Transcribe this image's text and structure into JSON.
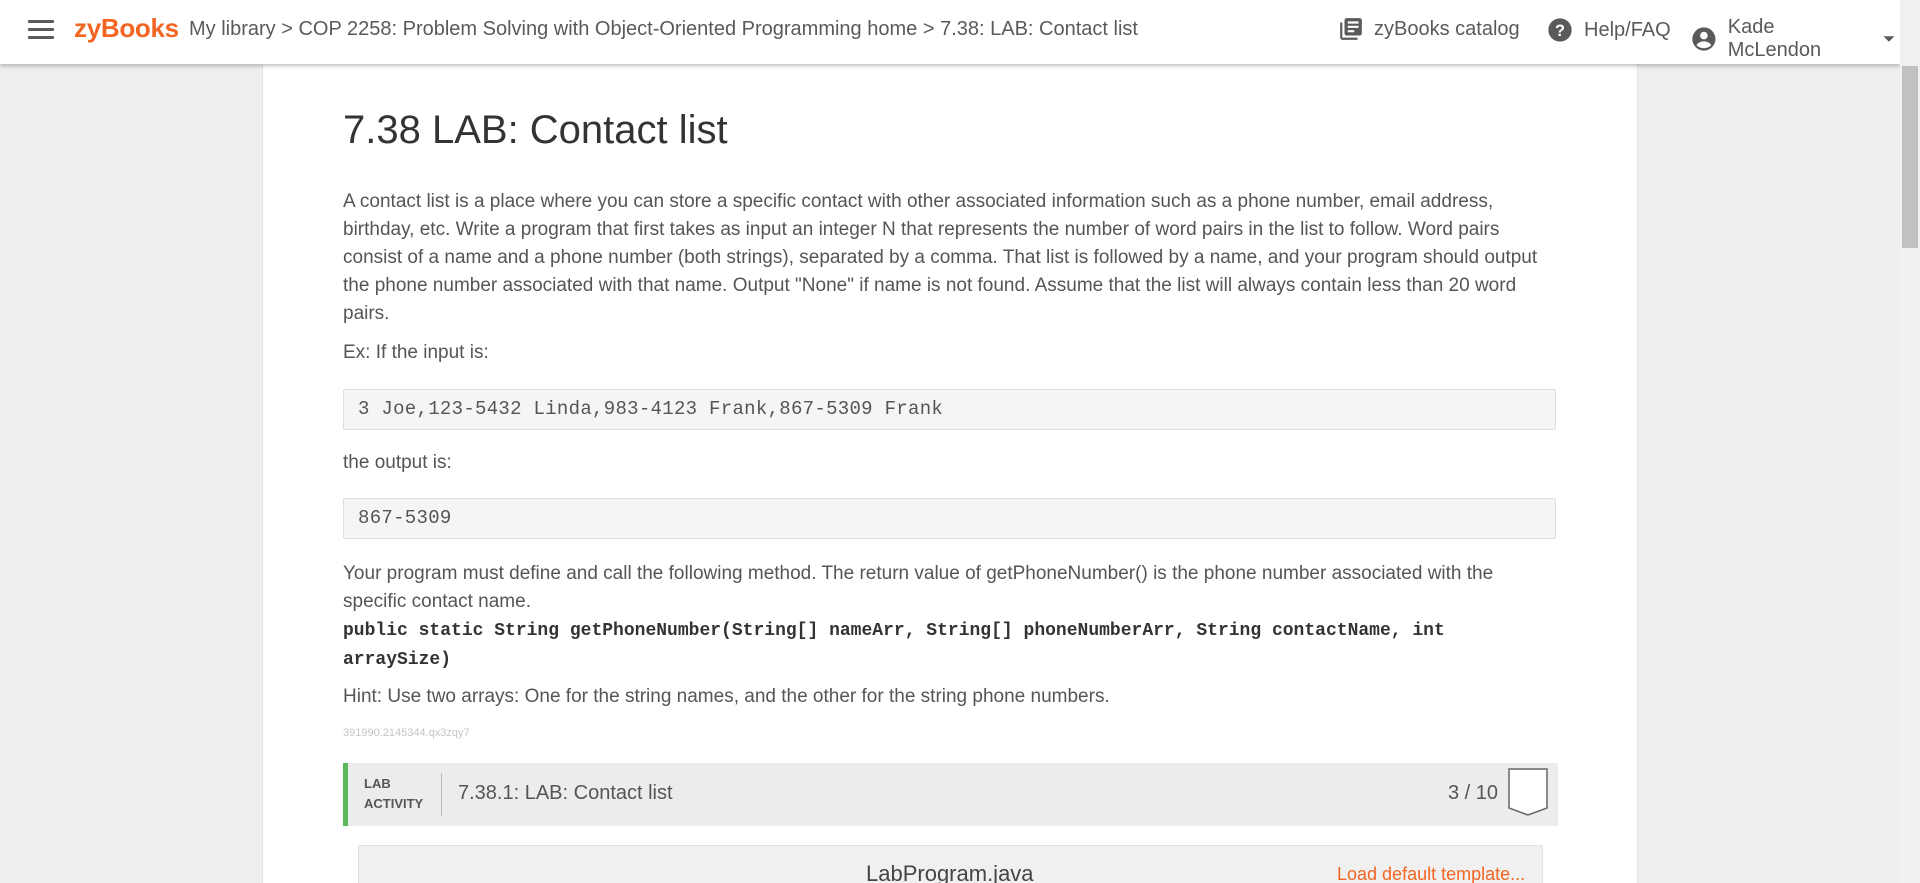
{
  "header": {
    "logo": "zyBooks",
    "breadcrumb": {
      "library": "My library",
      "sep1": " > ",
      "course": "COP 2258: Problem Solving with Object-Oriented Programming home",
      "sep2": " > ",
      "current": "7.38: LAB: Contact list"
    },
    "catalog_label": "zyBooks catalog",
    "help_label": "Help/FAQ",
    "user_name": "Kade McLendon"
  },
  "section": {
    "title": "7.38 LAB: Contact list",
    "description": "A contact list is a place where you can store a specific contact with other associated information such as a phone number, email address, birthday, etc. Write a program that first takes as input an integer N that represents the number of word pairs in the list to follow. Word pairs consist of a name and a phone number (both strings), separated by a comma. That list is followed by a name, and your program should output the phone number associated with that name. Output \"None\" if name is not found. Assume that the list will always contain less than 20 word pairs.",
    "example_label": "Ex: If the input is:",
    "example_input": "3 Joe,123-5432 Linda,983-4123 Frank,867-5309 Frank",
    "output_label": "the output is:",
    "example_output": "867-5309",
    "method_intro": "Your program must define and call the following method. The return value of getPhoneNumber() is the phone number associated with the specific contact name.",
    "method_signature": "public static String getPhoneNumber(String[] nameArr, String[] phoneNumberArr, String contactName, int arraySize)",
    "hint": "Hint: Use two arrays: One for the string names, and the other for the string phone numbers.",
    "tracking_id": "391990.2145344.qx3zqy7"
  },
  "lab": {
    "tag": "LAB ACTIVITY",
    "title": "7.38.1: LAB: Contact list",
    "score": "3 / 10",
    "file_name": "LabProgram.java",
    "load_template": "Load default template..."
  },
  "colors": {
    "brand": "#f26522",
    "lab_accent": "#5cb85c"
  }
}
